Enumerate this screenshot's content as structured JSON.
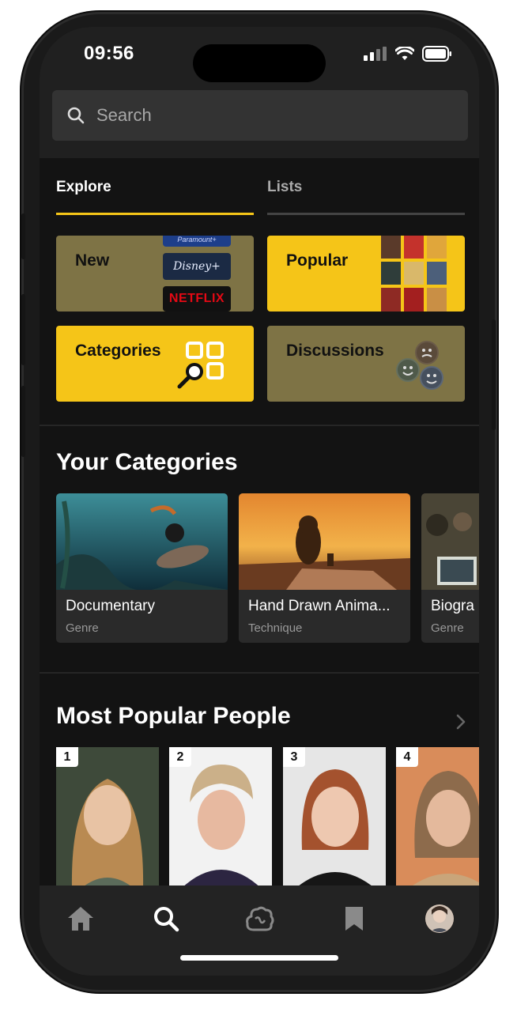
{
  "status_bar": {
    "time": "09:56"
  },
  "search": {
    "placeholder": "Search",
    "icon": "search-icon"
  },
  "tabs": [
    {
      "label": "Explore",
      "active": true
    },
    {
      "label": "Lists",
      "active": false
    }
  ],
  "tiles": [
    {
      "label": "New",
      "style": "olive",
      "streaming_logos": [
        "Paramount+",
        "Disney+",
        "NETFLIX"
      ]
    },
    {
      "label": "Popular",
      "style": "gold"
    },
    {
      "label": "Categories",
      "style": "gold",
      "icon": "grid-search-icon"
    },
    {
      "label": "Discussions",
      "style": "olive",
      "icon": "comedy-tragedy-masks-icon"
    }
  ],
  "your_categories": {
    "title": "Your Categories",
    "items": [
      {
        "title": "Documentary",
        "subtitle": "Genre"
      },
      {
        "title": "Hand Drawn Anima...",
        "subtitle": "Technique"
      },
      {
        "title": "Biogra",
        "subtitle": "Genre"
      }
    ]
  },
  "popular_people": {
    "title": "Most Popular People",
    "chevron": "chevron-right-icon",
    "items": [
      {
        "rank": "1"
      },
      {
        "rank": "2"
      },
      {
        "rank": "3"
      },
      {
        "rank": "4"
      }
    ]
  },
  "bottom_nav": [
    {
      "icon": "home-icon",
      "active": false
    },
    {
      "icon": "search-icon",
      "active": true
    },
    {
      "icon": "cloud-icon",
      "active": false
    },
    {
      "icon": "bookmark-icon",
      "active": false
    },
    {
      "icon": "profile-avatar",
      "active": false
    }
  ],
  "colors": {
    "accent": "#f5c518",
    "olive": "#7e7345",
    "background": "#131313"
  }
}
